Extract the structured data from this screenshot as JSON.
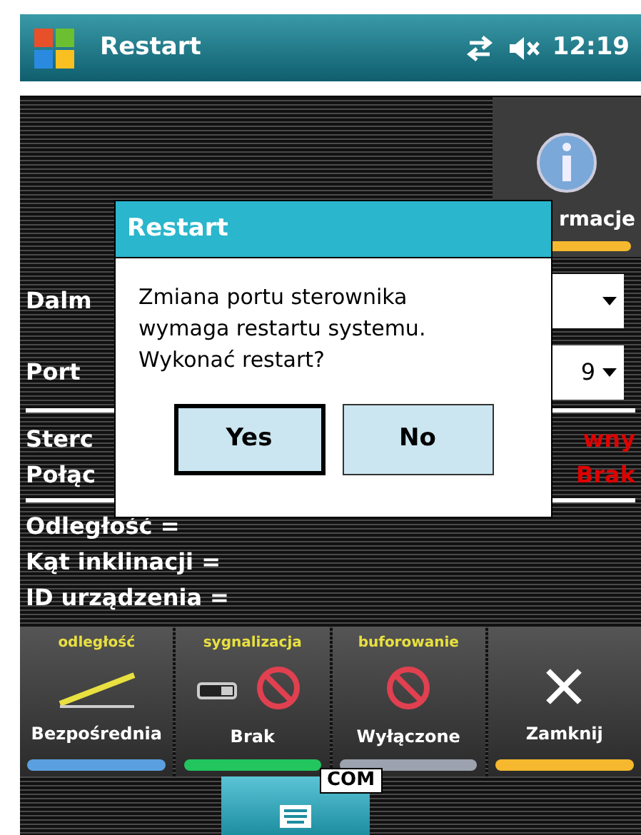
{
  "status_bar": {
    "title": "Restart",
    "time": "12:19"
  },
  "info_button": {
    "label": "rmacje"
  },
  "fields": [
    {
      "label": "Dalm"
    },
    {
      "label": "Port",
      "value": "9"
    }
  ],
  "status_rows": [
    {
      "label": "Sterc",
      "value": "wny"
    },
    {
      "label": "Połąc",
      "value": "Brak"
    }
  ],
  "readings": [
    "Odległość =",
    "Kąt inklinacji =",
    "ID urządzenia ="
  ],
  "tiles": [
    {
      "kind": "line",
      "caption": "odległość",
      "label": "Bezpośrednia",
      "color": "#5aa0e0"
    },
    {
      "kind": "blocked-switch",
      "caption": "sygnalizacja",
      "label": "Brak",
      "color": "#22c55e"
    },
    {
      "kind": "blocked",
      "caption": "buforowanie",
      "label": "Wyłączone",
      "color": "#9ca3af"
    },
    {
      "kind": "close",
      "label": "Zamknij",
      "color": "#f5b82e"
    }
  ],
  "port_label": "COM",
  "dialog": {
    "title": "Restart",
    "message": "Zmiana portu sterownika wymaga restartu systemu. Wykonać restart?",
    "buttons": [
      {
        "label": "Yes",
        "selected": true
      },
      {
        "label": "No",
        "selected": false
      }
    ]
  }
}
